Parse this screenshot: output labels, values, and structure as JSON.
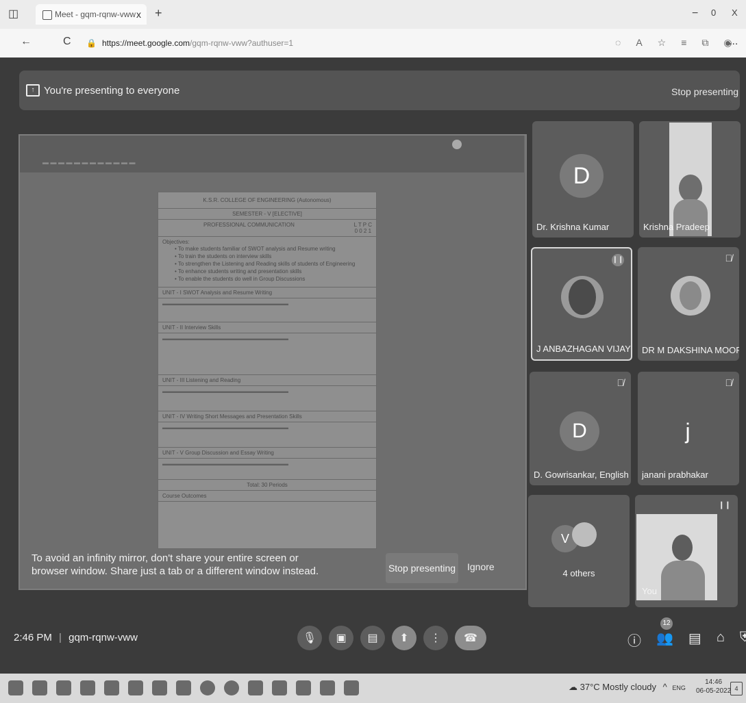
{
  "browser": {
    "tab_title": "Meet - gqm-rqnw-vww",
    "tab_close": "x",
    "new_tab": "+",
    "url_host": "https://meet.google.com",
    "url_path": "/gqm-rqnw-vww?authuser=1",
    "back": "←",
    "reload": "C",
    "win_min": "−",
    "win_max": "0",
    "win_close": "X",
    "menu": "..."
  },
  "banner": {
    "text": "You're presenting to everyone",
    "stop_label": "Stop presenting"
  },
  "shared_doc": {
    "college": "K.S.R. COLLEGE OF ENGINEERING (Autonomous)",
    "semester": "SEMESTER - V [ELECTIVE]",
    "course": "PROFESSIONAL COMMUNICATION",
    "ltpc": "L T P C",
    "ltpc_values": "0 0 2 1",
    "objectives_heading": "Objectives:",
    "objectives": [
      "To make students familiar of SWOT analysis and Resume writing",
      "To train the students on interview skills",
      "To strengthen the Listening and Reading skills of students of Engineering",
      "To enhance students writing and presentation skills",
      "To enable the students do well in Group Discussions"
    ],
    "unit1": "UNIT - I   SWOT Analysis and Resume Writing",
    "unit2": "UNIT - II   Interview Skills",
    "unit3": "UNIT - III   Listening and Reading",
    "unit4": "UNIT - IV   Writing Short Messages and Presentation Skills",
    "unit5": "UNIT - V   Group Discussion and Essay Writing",
    "total": "Total: 30 Periods",
    "outcomes": "Course Outcomes"
  },
  "warning": {
    "text": "To avoid an infinity mirror, don't share your entire screen or browser window. Share just a tab or a different window instead.",
    "stop_label": "Stop presenting",
    "ignore_label": "Ignore"
  },
  "participants": [
    {
      "name": "Dr. Krishna Kumar",
      "initial": "D"
    },
    {
      "name": "Krishna Pradeep"
    },
    {
      "name": "J ANBAZHAGAN VIJAY"
    },
    {
      "name": "DR M DAKSHINA MOORTHY"
    },
    {
      "name": "D. Gowrisankar, English",
      "initial": "D"
    },
    {
      "name": "janani prabhakar",
      "initial": "j"
    },
    {
      "name": "4 others",
      "initial": "V"
    },
    {
      "name": "You"
    }
  ],
  "meeting": {
    "time": "2:46 PM",
    "code": "gqm-rqnw-vww",
    "participant_count": "12"
  },
  "taskbar": {
    "weather": "37°C Mostly cloudy",
    "lang": "ENG",
    "time": "14:46",
    "date": "06-05-2022",
    "notif": "4"
  },
  "colors": {
    "meet_bg": "#3b3b3b",
    "tile_bg": "#5c5c5c",
    "end_call": "#c55a5a"
  }
}
